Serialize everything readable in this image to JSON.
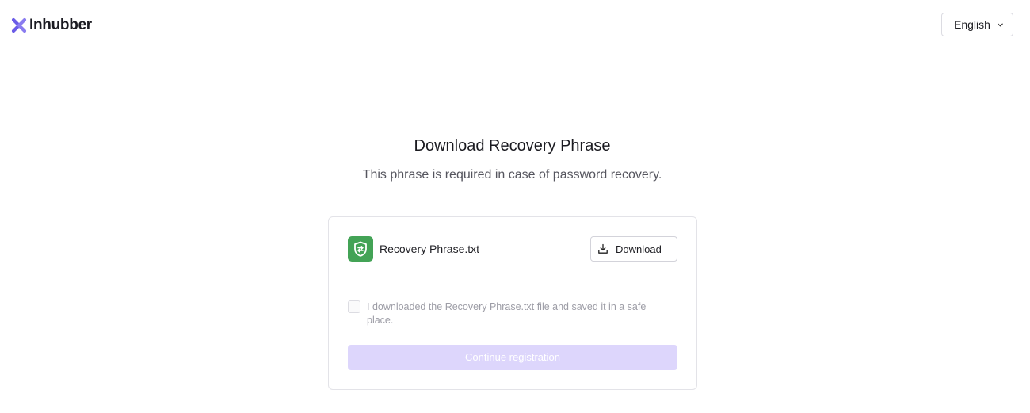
{
  "brand": {
    "name": "Inhubber",
    "logo_icon": "inhubber-x-logo",
    "accent_color": "#6b5ce7"
  },
  "header": {
    "language": {
      "selected": "English",
      "icon": "chevron-down-icon"
    }
  },
  "main": {
    "title": "Download Recovery Phrase",
    "subtitle": "This phrase is required in case of password recovery."
  },
  "card": {
    "file": {
      "name": "Recovery Phrase.txt",
      "icon": "shield-file-icon",
      "icon_color": "#43a356"
    },
    "download_button": {
      "label": "Download",
      "icon": "download-icon"
    },
    "confirmation": {
      "label": "I downloaded the Recovery Phrase.txt file and saved it in a safe place.",
      "checked": false
    },
    "continue_button": {
      "label": "Continue registration",
      "disabled": true,
      "color": "#ddd6fc"
    }
  }
}
